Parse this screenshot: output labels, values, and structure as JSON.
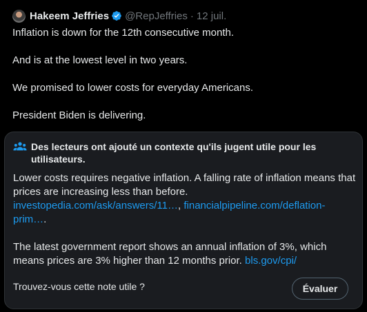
{
  "tweet": {
    "author_name": "Hakeem Jeffries",
    "handle": "@RepJeffries",
    "separator": "·",
    "date": "12 juil.",
    "lines": [
      "Inflation is down for the 12th consecutive month.",
      "And is at the lowest level in two years.",
      "We promised to lower costs for everyday Americans.",
      "President Biden is delivering."
    ]
  },
  "community_note": {
    "title": "Des lecteurs ont ajouté un contexte qu'ils jugent utile pour les utilisateurs.",
    "para1": "Lower costs requires negative inflation. A falling rate of inflation means that prices are increasing less than before.",
    "link1": "investopedia.com/ask/answers/11…",
    "link_sep": ", ",
    "link2": "financialpipeline.com/deflation-prim…",
    "para1_end": ".",
    "para2": "The latest government report shows an annual inflation of 3%, which means prices are 3% higher than 12 months prior.",
    "link3": "bls.gov/cpi/",
    "helpful_question": "Trouvez-vous cette note utile ?",
    "rate_button": "Évaluer"
  },
  "colors": {
    "background": "#000000",
    "text": "#e7e9ea",
    "muted": "#71767b",
    "link": "#1d9bf0",
    "verified": "#1d9bf0",
    "note_bg": "#1a1c20"
  },
  "icons": {
    "verified": "verified-badge-icon",
    "note": "people-group-icon"
  }
}
